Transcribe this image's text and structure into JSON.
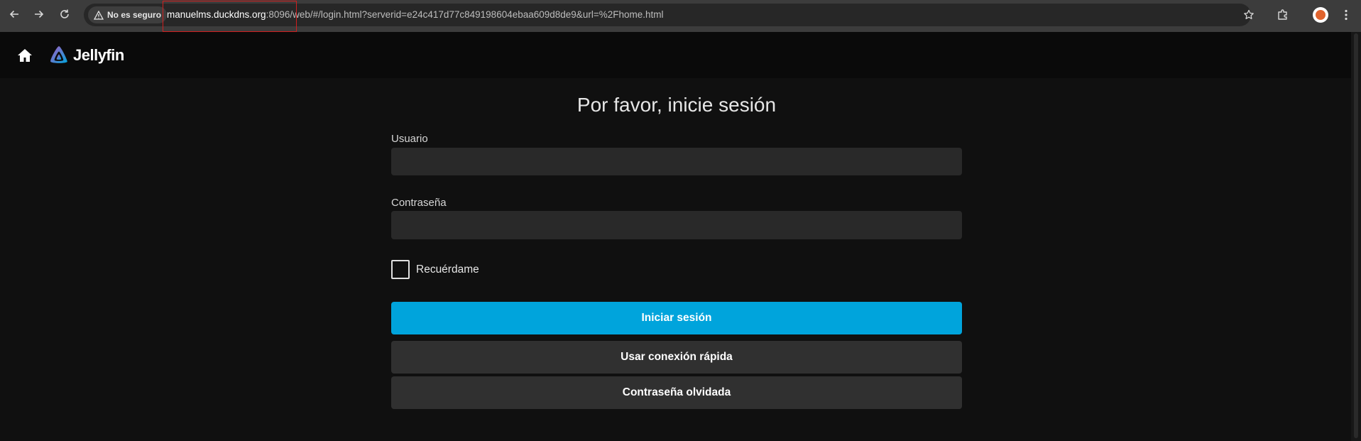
{
  "browser": {
    "security_chip": "No es seguro",
    "url_host": "manuelms.duckdns.org",
    "url_rest": ":8096/web/#/login.html?serverid=e24c417d77c849198604ebaa609d8de9&url=%2Fhome.html"
  },
  "app": {
    "brand": "Jellyfin"
  },
  "login": {
    "title": "Por favor, inicie sesión",
    "username_label": "Usuario",
    "username_value": "",
    "password_label": "Contraseña",
    "password_value": "",
    "remember_label": "Recuérdame",
    "remember_checked": false,
    "sign_in_button": "Iniciar sesión",
    "quick_connect_button": "Usar conexión rápida",
    "forgot_password_button": "Contraseña olvidada"
  },
  "colors": {
    "accent": "#00a4dc",
    "background": "#101010",
    "input_bg": "#292929",
    "secondary_button": "#303030",
    "highlight_box": "#d01f1f"
  }
}
